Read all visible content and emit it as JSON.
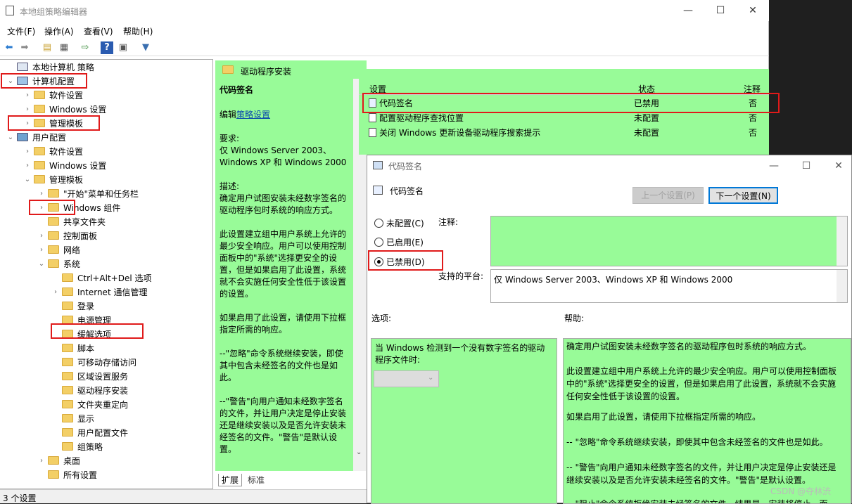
{
  "window": {
    "title": "本地组策略编辑器"
  },
  "menu": [
    "文件(F)",
    "操作(A)",
    "查看(V)",
    "帮助(H)"
  ],
  "tree": [
    {
      "label": "本地计算机 策略",
      "arrow": ""
    },
    {
      "label": "计算机配置",
      "arrow": "⌄"
    },
    {
      "label": "软件设置",
      "arrow": "›"
    },
    {
      "label": "Windows 设置",
      "arrow": "›"
    },
    {
      "label": "管理模板",
      "arrow": "›"
    },
    {
      "label": "用户配置",
      "arrow": "⌄"
    },
    {
      "label": "软件设置",
      "arrow": "›"
    },
    {
      "label": "Windows 设置",
      "arrow": "›"
    },
    {
      "label": "管理模板",
      "arrow": "⌄"
    },
    {
      "label": "\"开始\"菜单和任务栏",
      "arrow": "›"
    },
    {
      "label": "Windows 组件",
      "arrow": "›"
    },
    {
      "label": "共享文件夹",
      "arrow": ""
    },
    {
      "label": "控制面板",
      "arrow": "›"
    },
    {
      "label": "网络",
      "arrow": "›"
    },
    {
      "label": "系统",
      "arrow": "⌄"
    },
    {
      "label": "Ctrl+Alt+Del 选项",
      "arrow": ""
    },
    {
      "label": "Internet 通信管理",
      "arrow": "›"
    },
    {
      "label": "登录",
      "arrow": ""
    },
    {
      "label": "电源管理",
      "arrow": ""
    },
    {
      "label": "缓解选项",
      "arrow": ""
    },
    {
      "label": "脚本",
      "arrow": ""
    },
    {
      "label": "可移动存储访问",
      "arrow": ""
    },
    {
      "label": "区域设置服务",
      "arrow": ""
    },
    {
      "label": "驱动程序安装",
      "arrow": ""
    },
    {
      "label": "文件夹重定向",
      "arrow": ""
    },
    {
      "label": "显示",
      "arrow": ""
    },
    {
      "label": "用户配置文件",
      "arrow": ""
    },
    {
      "label": "组策略",
      "arrow": ""
    },
    {
      "label": "桌面",
      "arrow": "›"
    },
    {
      "label": "所有设置",
      "arrow": ""
    }
  ],
  "status": "3 个设置",
  "panel": {
    "folder_title": "驱动程序安装",
    "desc_title": "代码签名",
    "edit_prefix": "编辑",
    "edit_link": "策略设置",
    "req_label": "要求:",
    "req_text": "仅 Windows Server 2003、Windows XP 和 Windows 2000",
    "desc_label": "描述:",
    "desc1": "确定用户试图安装未经数字签名的驱动程序包时系统的响应方式。",
    "desc2": "此设置建立组中用户系统上允许的最少安全响应。用户可以使用控制面板中的\"系统\"选择更安全的设置，但是如果启用了此设置，系统就不会实施任何安全性低于该设置的设置。",
    "desc3": "如果启用了此设置，请使用下拉框指定所需的响应。",
    "desc4": "--\"忽略\"命令系统继续安装，即使其中包含未经签名的文件也是如此。",
    "desc5": "--\"警告\"向用户通知未经数字签名的文件，并让用户决定是停止安装还是继续安装以及是否允许安装未经签名的文件。\"警告\"是默认设置。",
    "tabs": [
      "扩展",
      "标准"
    ]
  },
  "list": {
    "headers": [
      "设置",
      "状态",
      "注释"
    ],
    "rows": [
      {
        "name": "代码签名",
        "state": "已禁用",
        "note": "否"
      },
      {
        "name": "配置驱动程序查找位置",
        "state": "未配置",
        "note": "否"
      },
      {
        "name": "关闭 Windows 更新设备驱动程序搜索提示",
        "state": "未配置",
        "note": "否"
      }
    ]
  },
  "dialog": {
    "title": "代码签名",
    "heading": "代码签名",
    "prev": "上一个设置(P)",
    "next": "下一个设置(N)",
    "radios": [
      "未配置(C)",
      "已启用(E)",
      "已禁用(D)"
    ],
    "comment_label": "注释:",
    "platform_label": "支持的平台:",
    "platform_value": "仅 Windows Server 2003、Windows XP 和 Windows 2000",
    "options_label": "选项:",
    "help_label": "帮助:",
    "option_text": "当 Windows 检测到一个没有数字签名的驱动程序文件时:",
    "help": [
      "确定用户试图安装未经数字签名的驱动程序包时系统的响应方式。",
      "此设置建立组中用户系统上允许的最少安全响应。用户可以使用控制面板中的\"系统\"选择更安全的设置，但是如果启用了此设置，系统就不会实施任何安全性低于该设置的设置。",
      "如果启用了此设置，请使用下拉框指定所需的响应。",
      "-- \"忽略\"命令系统继续安装，即使其中包含未经签名的文件也是如此。",
      "-- \"警告\"向用户通知未经数字签名的文件，并让用户决定是停止安装还是继续安装以及是否允许安装未经签名的文件。\"警告\"是默认设置。",
      "-- \"阻止\"命令系统拒绝安装未经签名的文件。结果是，安装将停止，而"
    ]
  },
  "watermark": "CSDN @夺林渋",
  "colors": {
    "green": "#98fb98",
    "highlight": "#e01a1a"
  }
}
